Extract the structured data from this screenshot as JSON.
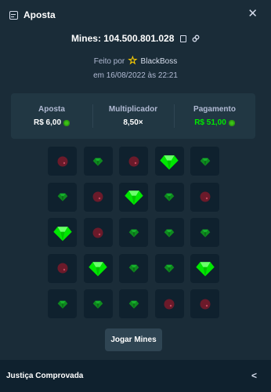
{
  "header": {
    "title": "Aposta",
    "icon": "bet-slip-icon",
    "close_icon": "close-icon"
  },
  "bet": {
    "id_text": "Mines: 104.500.801.028",
    "placed_by_prefix": "Feito por",
    "username": "BlackBoss",
    "date_text": "em 16/08/2022 às 22:21"
  },
  "stats": {
    "bet_label": "Aposta",
    "bet_value": "R$ 6,00",
    "multiplier_label": "Multiplicador",
    "multiplier_value": "8,50×",
    "payout_label": "Pagamento",
    "payout_value": "R$ 51,00"
  },
  "board": {
    "rows": [
      [
        "mine",
        "gem",
        "mine",
        "gem-revealed",
        "gem"
      ],
      [
        "gem",
        "mine",
        "gem-revealed",
        "gem",
        "mine"
      ],
      [
        "gem-revealed",
        "mine",
        "gem",
        "gem",
        "gem"
      ],
      [
        "mine",
        "gem-revealed",
        "gem",
        "gem",
        "gem-revealed"
      ],
      [
        "gem",
        "gem",
        "gem",
        "mine",
        "mine"
      ]
    ]
  },
  "play_button": "Jogar Mines",
  "footer": {
    "label": "Justiça Comprovada"
  },
  "colors": {
    "background": "#1a2c38",
    "panel": "#213743",
    "tile": "#0f212e",
    "gem_bright": "#00e701",
    "gem_dim": "#0e8a1f",
    "mine": "#6b1a2a",
    "payout_green": "#00e701",
    "coin": "#3bc117"
  }
}
